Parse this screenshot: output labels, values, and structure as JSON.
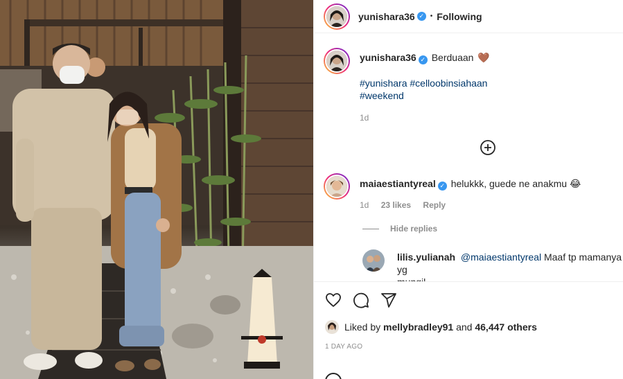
{
  "header": {
    "username": "yunishara36",
    "separator": "•",
    "follow_status": "Following"
  },
  "caption": {
    "username": "yunishara36",
    "text": "Berduaan",
    "emoji": "🤎",
    "hashtags_line1": "#yunishara #celloobinsiahaan",
    "hashtags_line2": "#weekend",
    "age": "1d"
  },
  "comment": {
    "username": "maiaestiantyreal",
    "text": "helukkk, guede ne anakmu",
    "emoji": "😂",
    "age": "1d",
    "likes": "23 likes",
    "reply_label": "Reply",
    "hide_replies": "Hide replies"
  },
  "reply": {
    "username": "lilis.yulianah",
    "mention": "@maiaestiantyreal",
    "text_line1": "Maaf tp mamanya yg",
    "text_line2": "mungil."
  },
  "likes": {
    "prefix": "Liked by",
    "user": "mellybradley91",
    "middle": "and",
    "count": "46,447 others"
  },
  "post_age": "1 DAY AGO",
  "colors": {
    "verified": "#3897f0",
    "hashtag": "#00376b",
    "muted": "#8e8e8e"
  }
}
